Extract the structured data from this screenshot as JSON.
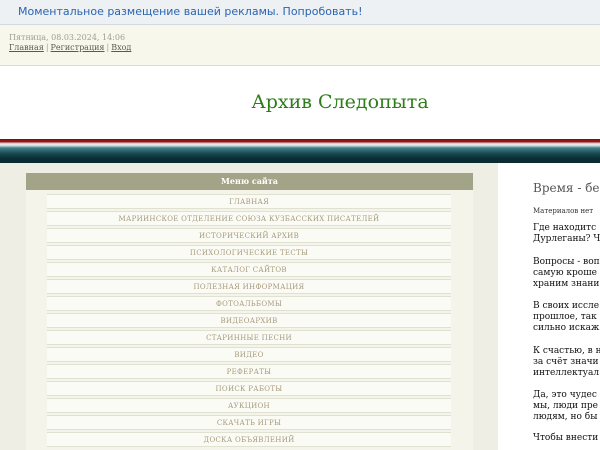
{
  "ad_bar": {
    "text": "Моментальное размещение вашей рекламы. Попробовать!"
  },
  "user_bar": {
    "date": "Пятница, 08.03.2024, 14:06",
    "links": [
      "Главная",
      "Регистрация",
      "Вход"
    ],
    "separator": "|"
  },
  "header": {
    "site_title": "Архив Следопыта"
  },
  "sidebar": {
    "heading": "Меню сайта",
    "items": [
      "ГЛАВНАЯ",
      "МАРИИНСКОЕ ОТДЕЛЕНИЕ СОЮЗА КУЗБАССКИХ ПИСАТЕЛЕЙ",
      "ИСТОРИЧЕСКИЙ АРХИВ",
      "ПСИХОЛОГИЧЕСКИЕ ТЕСТЫ",
      "КАТАЛОГ САЙТОВ",
      "ПОЛЕЗНАЯ ИНФОРМАЦИЯ",
      "ФОТОАЛЬБОМЫ",
      "ВИДЕОАРХИВ",
      "СТАРИННЫЕ ПЕСНИ",
      "ВИДЕО",
      "РЕФЕРАТЫ",
      "ПОИСК РАБОТЫ",
      "АУКЦИОН",
      "СКАЧАТЬ ИГРЫ",
      "ДОСКА ОБЪЯВЛЕНИЙ"
    ]
  },
  "content": {
    "title": "Время - бес",
    "meta": "Материалов нет",
    "paragraphs": [
      "Где находитс",
      "Дурлеганы? Ч",
      "Вопросы - воп",
      "самую кроше",
      "храним знани",
      "В своих иссле",
      "прошлое, так",
      "сильно искаж",
      "К счастью, в н",
      "за счёт значи",
      "интеллектуал",
      "Да, это чудес",
      "мы, люди пре",
      "людям, но бы",
      "Чтобы внести"
    ]
  },
  "colors": {
    "link_blue": "#2a64b0",
    "title_green": "#2e7d1a",
    "menu_text": "#a69a7c",
    "sidebar_header": "#a3a387",
    "stripe_red": "#a01818",
    "stripe_teal": "#1c4e56"
  }
}
